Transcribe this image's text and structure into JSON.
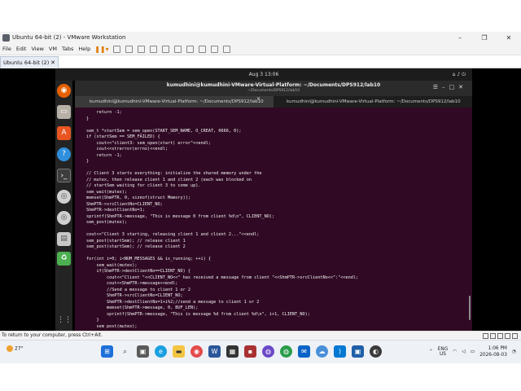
{
  "vmware": {
    "window_title": "Ubuntu 64-bit (2) - VMware Workstation",
    "menu": [
      "File",
      "Edit",
      "View",
      "VM",
      "Tabs",
      "Help"
    ],
    "tab_label": "Ubuntu 64-bit (2)",
    "tab_close": "✕",
    "window_controls": [
      "–",
      "❐",
      "✕"
    ],
    "status_text": "To return to your computer, press Ctrl+Alt."
  },
  "gnome": {
    "clock": "Aug 3  13:06"
  },
  "terminal": {
    "title": "kumudhini@kumudhini-VMware-Virtual-Platform: ~/Documents/DPS912/lab10",
    "path": "~/Documents/DPS912/lab10",
    "tabs": [
      "kumudhini@kumudhini-VMware-Virtual-Platform: ~/Documents/DPS912/lab10",
      "kumudhini@kumudhini-VMware-Virtual-Platform: ~/Documents/DPS912/lab10"
    ],
    "code_lines": [
      "    return -1;",
      "}",
      "",
      "sem_t *startSem = sem_open(START_SEM_NAME, O_CREAT, 0666, 0);",
      "if (startSem == SEM_FAILED) {",
      "    cout<<\"client3: sem_open(start) error\"<<endl;",
      "    cout<<strerror(errno)<<endl;",
      "    return -1;",
      "}",
      "",
      "// Client 3 starts everything: initialize the shared memory under the",
      "// mutex, then release client 1 and client 2 (each was blocked on",
      "// startSem waiting for client 3 to come up).",
      "sem_wait(mutex);",
      "memset(ShmPTR, 0, sizeof(struct Memory));",
      "ShmPTR->srcClientNo=CLIENT_NO;",
      "ShmPTR->destClientNo=1;",
      "sprintf(ShmPTR->message, \"This is message 0 from client %d\\n\", CLIENT_NO);",
      "sem_post(mutex);",
      "",
      "cout<<\"Client 3 starting, releasing client 1 and client 2...\"<<endl;",
      "sem_post(startSem); // release client 1",
      "sem_post(startSem); // release client 2",
      "",
      "for(int i=0; i<NUM_MESSAGES && is_running; ++i) {",
      "    sem_wait(mutex);",
      "    if(ShmPTR->destClientNo==CLIENT_NO) {",
      "        cout<<\"Client \"<<CLIENT_NO<<\" has received a message from client \"<<ShmPTR->srcClientNo<<\":\"<<endl;",
      "        cout<<ShmPTR->message<<endl;",
      "        //Send a message to client 1 or 2",
      "        ShmPTR->srcClientNo=CLIENT_NO;",
      "        ShmPTR->destClientNo=1+i%2;//send a message to client 1 or 2",
      "        memset(ShmPTR->message, 0, BUF_LEN);",
      "        sprintf(ShmPTR->message, \"This is message %d from client %d\\n\", i+1, CLIENT_NO);",
      "    }",
      "    sem_post(mutex);",
      "    sleep(1);"
    ]
  },
  "taskbar": {
    "weather_temp": "27°",
    "lang_top": "ENG",
    "lang_bottom": "US",
    "time": "1:06 PM",
    "date": "2026-08-03"
  },
  "colors": {
    "terminal_bg": "#300a24",
    "dock_bg": "#242424",
    "topbar_bg": "#1c1c1c"
  }
}
